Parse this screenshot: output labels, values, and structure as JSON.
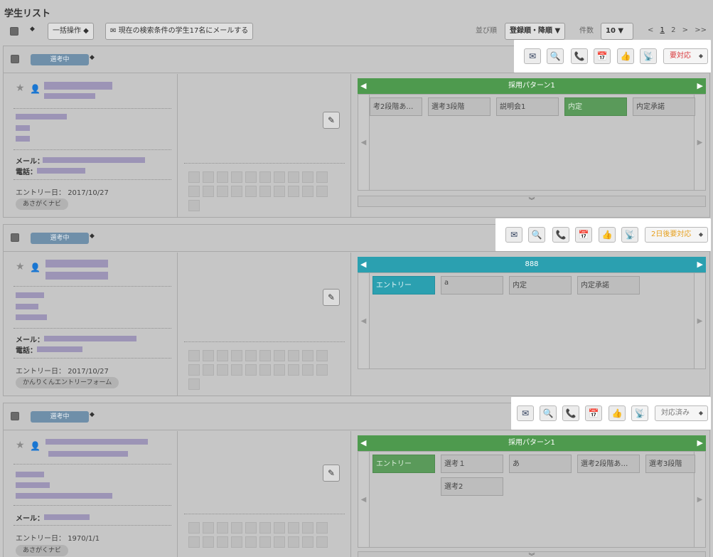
{
  "page": {
    "title": "学生リスト"
  },
  "toolbar": {
    "bulk_label": "一括操作 ◆",
    "mail_label": "現在の検索条件の学生17名にメールする",
    "sort_label": "並び順",
    "sort_value": "登録順・降順 ▼",
    "count_label": "件数",
    "count_value": "10 ▼"
  },
  "pager": {
    "prev": "<",
    "pages": [
      "1",
      "2"
    ],
    "next": ">",
    "last": ">>"
  },
  "icons": {
    "mail": "✉",
    "search_doc": "🔍",
    "phone": "📞",
    "calendar": "📅",
    "like": "👍",
    "broadcast": "📡",
    "memo": "✎",
    "star": "★",
    "person": "👤"
  },
  "colors": {
    "pattern_green": "#5a9a5a",
    "pattern_teal": "#2ba0b0",
    "urgent_red": "#d9373a",
    "warn_orange": "#e6a01e"
  },
  "labels": {
    "mail": "メール：",
    "phone": "電話：",
    "entry": "エントリー日："
  },
  "cards": [
    {
      "status": "選考中",
      "response": "要対応",
      "entry_date": "2017/10/27",
      "source": "あさがくナビ",
      "flow_title": "採用パターン1",
      "steps": [
        "考2段階あ…",
        "選考3段階",
        "説明会1",
        "内定",
        "内定承諾"
      ],
      "active_step": 3
    },
    {
      "status": "選考中",
      "response": "2日後要対応",
      "entry_date": "2017/10/27",
      "source": "かんりくんエントリーフォーム",
      "flow_title": "888",
      "steps": [
        "エントリー",
        "a",
        "内定",
        "内定承諾"
      ],
      "active_step": 0
    },
    {
      "status": "選考中",
      "response": "対応済み",
      "entry_date": "1970/1/1",
      "source": "あさがくナビ",
      "flow_title": "採用パターン1",
      "steps": [
        "エントリー",
        "選考１",
        "あ",
        "選考2段階あ…",
        "選考3段階",
        "選考2"
      ],
      "active_step": 0
    }
  ]
}
